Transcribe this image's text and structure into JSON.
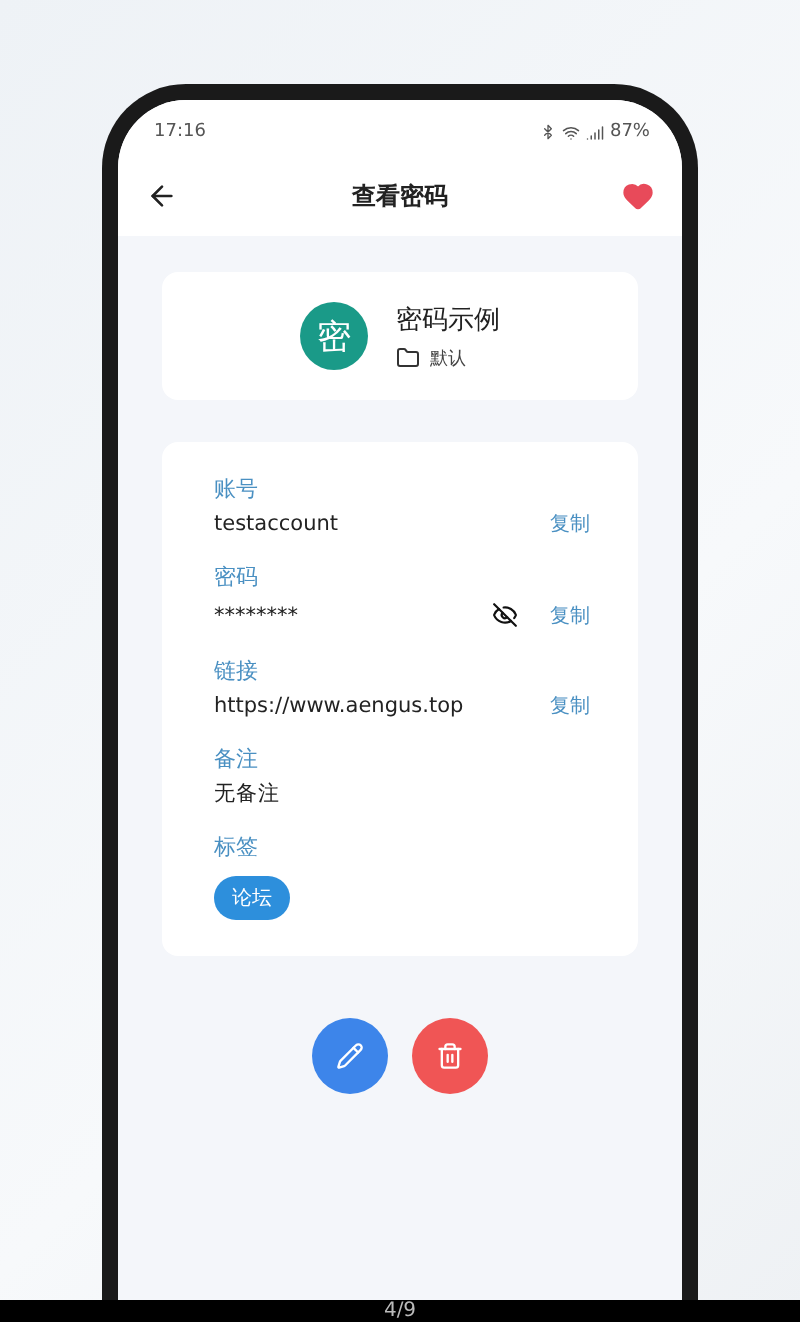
{
  "status_bar": {
    "time": "17:16",
    "battery": "87%"
  },
  "toolbar": {
    "title": "查看密码",
    "favorite": true
  },
  "entry": {
    "avatar": "密",
    "name": "密码示例",
    "folder": "默认"
  },
  "fields": [
    {
      "label": "账号",
      "value": "testaccount",
      "copy": "复制"
    },
    {
      "label": "密码",
      "value": "********",
      "masked": true,
      "copy": "复制"
    },
    {
      "label": "链接",
      "value": "https://www.aengus.top",
      "copy": "复制"
    },
    {
      "label": "备注",
      "value": "无备注"
    }
  ],
  "tags_label": "标签",
  "tags": [
    "论坛"
  ],
  "page_counter": "4/9"
}
